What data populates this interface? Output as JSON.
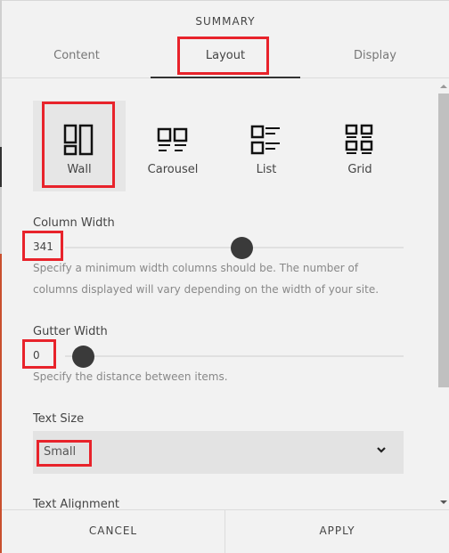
{
  "dialog": {
    "title": "SUMMARY",
    "tabs": [
      {
        "label": "Content",
        "active": false
      },
      {
        "label": "Layout",
        "active": true
      },
      {
        "label": "Display",
        "active": false
      }
    ]
  },
  "layout_options": [
    {
      "label": "Wall",
      "icon": "wall-layout-icon",
      "selected": true
    },
    {
      "label": "Carousel",
      "icon": "carousel-layout-icon",
      "selected": false
    },
    {
      "label": "List",
      "icon": "list-layout-icon",
      "selected": false
    },
    {
      "label": "Grid",
      "icon": "grid-layout-icon",
      "selected": false
    }
  ],
  "column_width": {
    "label": "Column Width",
    "value": "341",
    "slider_fraction": 0.52,
    "help": "Specify a minimum width columns should be. The number of columns displayed will vary depending on the width of your site."
  },
  "gutter_width": {
    "label": "Gutter Width",
    "value": "0",
    "slider_fraction": 0.0,
    "help": "Specify the distance between items."
  },
  "text_size": {
    "label": "Text Size",
    "selected": "Small"
  },
  "text_alignment": {
    "label": "Text Alignment"
  },
  "footer": {
    "cancel_label": "CANCEL",
    "apply_label": "APPLY"
  },
  "colors": {
    "highlight": "#e8232b",
    "thumb": "#3a3a3a",
    "background": "#f2f2f2"
  }
}
